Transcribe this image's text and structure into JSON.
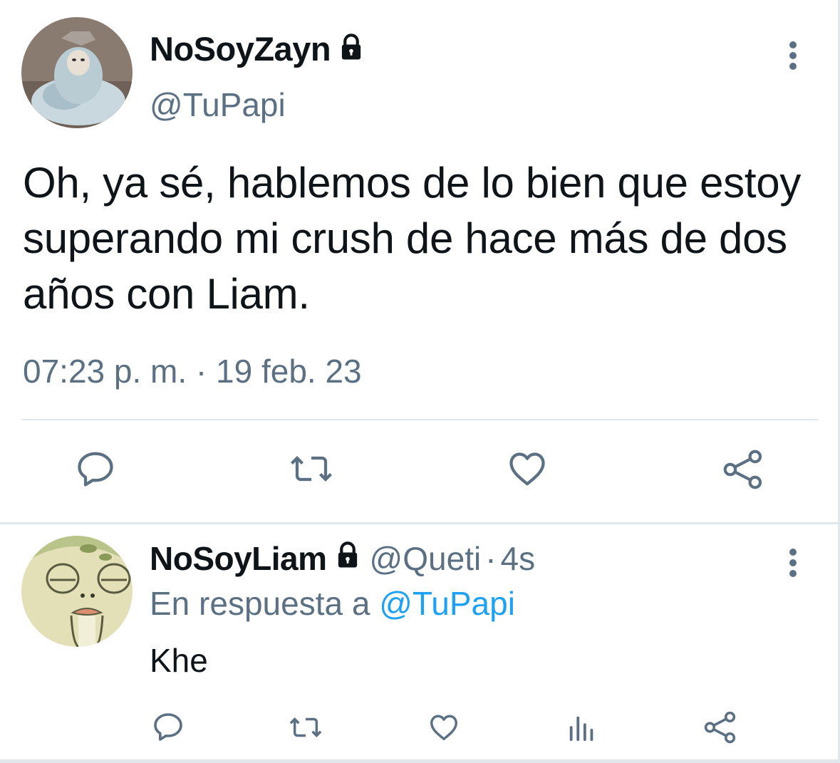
{
  "main_tweet": {
    "display_name": "NoSoyZayn",
    "handle": "@TuPapi",
    "text": "Oh, ya sé, hablemos de lo bien que estoy superando mi crush de hace más de dos años con Liam.",
    "timestamp": "07:23 p. m. · 19 feb. 23",
    "icons": [
      "lock-icon",
      "more-icon",
      "reply-icon",
      "retweet-icon",
      "like-icon",
      "share-icon"
    ]
  },
  "reply_tweet": {
    "display_name": "NoSoyLiam",
    "handle": "@Queti",
    "separator": "·",
    "time_ago": "4s",
    "context_prefix": "En respuesta a",
    "context_mention": "@TuPapi",
    "text": "Khe",
    "icons": [
      "lock-icon",
      "more-icon",
      "reply-icon",
      "retweet-icon",
      "like-icon",
      "analytics-icon",
      "share-icon"
    ]
  },
  "colors": {
    "text": "#0f1419",
    "secondary": "#5b7083",
    "link": "#1da1f2",
    "divider": "#e1e8ed"
  }
}
